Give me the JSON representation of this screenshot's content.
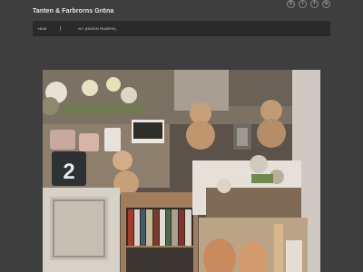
{
  "site": {
    "title": "Tanten & Farbrorns Gröna"
  },
  "social": [
    {
      "icon": "skype-icon",
      "glyph": "S"
    },
    {
      "icon": "twitter-icon",
      "glyph": "t"
    },
    {
      "icon": "facebook-icon",
      "glyph": "f"
    },
    {
      "icon": "linkedin-icon",
      "glyph": "in"
    }
  ],
  "nav": {
    "items": [
      {
        "label": "Hem"
      },
      {
        "label": "Ny (Ingen rubrik)"
      }
    ]
  },
  "photo": {
    "price_tag": "2"
  }
}
